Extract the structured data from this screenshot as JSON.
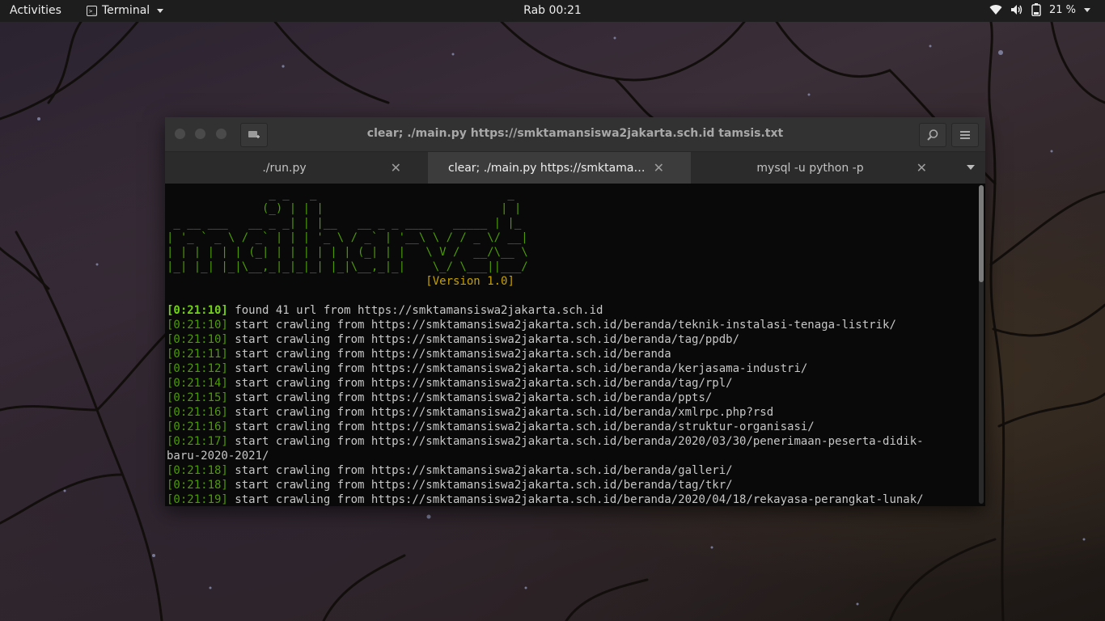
{
  "topbar": {
    "activities": "Activities",
    "app_name": "Terminal",
    "clock": "Rab 00:21",
    "battery": "21 %",
    "icons": [
      "wifi-icon",
      "volume-icon",
      "battery-icon",
      "chevron-down-icon"
    ]
  },
  "window": {
    "title": "clear; ./main.py https://smktamansiswa2jakarta.sch.id tamsis.txt",
    "icons": [
      "new-tab-icon",
      "search-icon",
      "hamburger-menu-icon"
    ]
  },
  "tabs": [
    {
      "label": "./run.py"
    },
    {
      "label": "clear; ./main.py https://smktamansiswa2jakarta.sch.id tamsis.txt"
    },
    {
      "label": "mysql -u python -p"
    }
  ],
  "terminal": {
    "banner": [
      "               _ _   _                            _ ",
      "              (_) | | |                          | |",
      " _ __ ___   __ _ _| | |__   __ _ _ ____   _____ | |_",
      "| '_ ` _ \\ / _` | | | '_ \\ / _` | '__\\ \\ / / _ \\/ __|",
      "| | | | | | (_| | | | | | | (_| | |   \\ V /  __/\\__ \\",
      "|_| |_| |_|\\__,_|_|_|_| |_|\\__,_|_|    \\_/ \\___||___/"
    ],
    "version": "[Version 1.0]",
    "log": [
      {
        "time": "[0:21:10]",
        "text": " found 41 url from https://smktamansiswa2jakarta.sch.id"
      },
      {
        "time": "[0:21:10]",
        "text": " start crawling from https://smktamansiswa2jakarta.sch.id/beranda/teknik-instalasi-tenaga-listrik/"
      },
      {
        "time": "[0:21:10]",
        "text": " start crawling from https://smktamansiswa2jakarta.sch.id/beranda/tag/ppdb/"
      },
      {
        "time": "[0:21:11]",
        "text": " start crawling from https://smktamansiswa2jakarta.sch.id/beranda"
      },
      {
        "time": "[0:21:12]",
        "text": " start crawling from https://smktamansiswa2jakarta.sch.id/beranda/kerjasama-industri/"
      },
      {
        "time": "[0:21:14]",
        "text": " start crawling from https://smktamansiswa2jakarta.sch.id/beranda/tag/rpl/"
      },
      {
        "time": "[0:21:15]",
        "text": " start crawling from https://smktamansiswa2jakarta.sch.id/beranda/ppts/"
      },
      {
        "time": "[0:21:16]",
        "text": " start crawling from https://smktamansiswa2jakarta.sch.id/beranda/xmlrpc.php?rsd"
      },
      {
        "time": "[0:21:16]",
        "text": " start crawling from https://smktamansiswa2jakarta.sch.id/beranda/struktur-organisasi/"
      },
      {
        "time": "[0:21:17]",
        "text": " start crawling from https://smktamansiswa2jakarta.sch.id/beranda/2020/03/30/penerimaan-peserta-didik-"
      },
      {
        "time": "",
        "text": "baru-2020-2021/"
      },
      {
        "time": "[0:21:18]",
        "text": " start crawling from https://smktamansiswa2jakarta.sch.id/beranda/galleri/"
      },
      {
        "time": "[0:21:18]",
        "text": " start crawling from https://smktamansiswa2jakarta.sch.id/beranda/tag/tkr/"
      },
      {
        "time": "[0:21:19]",
        "text": " start crawling from https://smktamansiswa2jakarta.sch.id/beranda/2020/04/18/rekayasa-perangkat-lunak/"
      }
    ]
  },
  "colors": {
    "art": "#4e9a06",
    "version": "#c4a000",
    "timestamp": "#4e9a06",
    "first_timestamp": "#73d216"
  }
}
